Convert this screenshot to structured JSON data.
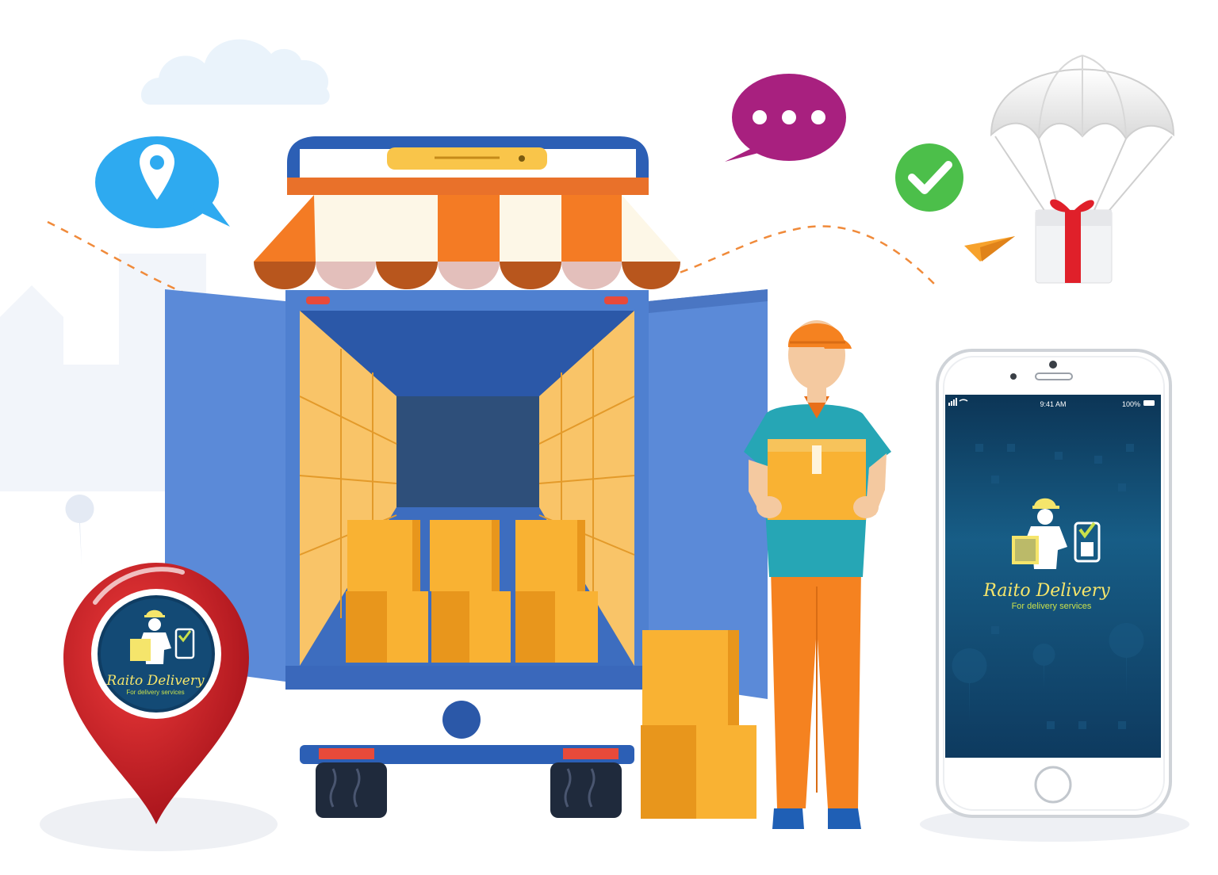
{
  "brand": {
    "name": "Raito Delivery",
    "tagline": "For delivery services",
    "colors": {
      "yellow": "#f5e56b",
      "green": "#c9e04b",
      "dark_blue": "#0f3d63"
    }
  },
  "phone": {
    "status_time": "9:41 AM",
    "status_battery": "100%",
    "screen_color": "#124a73"
  },
  "map_pin": {
    "color": "#d01f25"
  },
  "icons": [
    "cloud-icon",
    "location-chat-bubble-icon",
    "typing-chat-bubble-icon",
    "checkmark-icon",
    "paper-plane-icon",
    "parachute-gift-icon",
    "delivery-truck-store",
    "delivery-man",
    "smartphone",
    "map-pin-logo"
  ],
  "colors": {
    "truck_blue": "#4a7bd0",
    "truck_dark_blue": "#2b58a8",
    "awning_orange": "#f47b24",
    "awning_cream": "#fdf7e7",
    "box_yellow": "#f9b233",
    "box_dark": "#e8961c",
    "uniform_orange": "#f58220",
    "shirt_teal": "#26a6b5",
    "bubble_blue": "#2eaaf0",
    "bubble_purple": "#a8207f",
    "check_green": "#4cbf4a",
    "gift_red": "#e0202a"
  }
}
